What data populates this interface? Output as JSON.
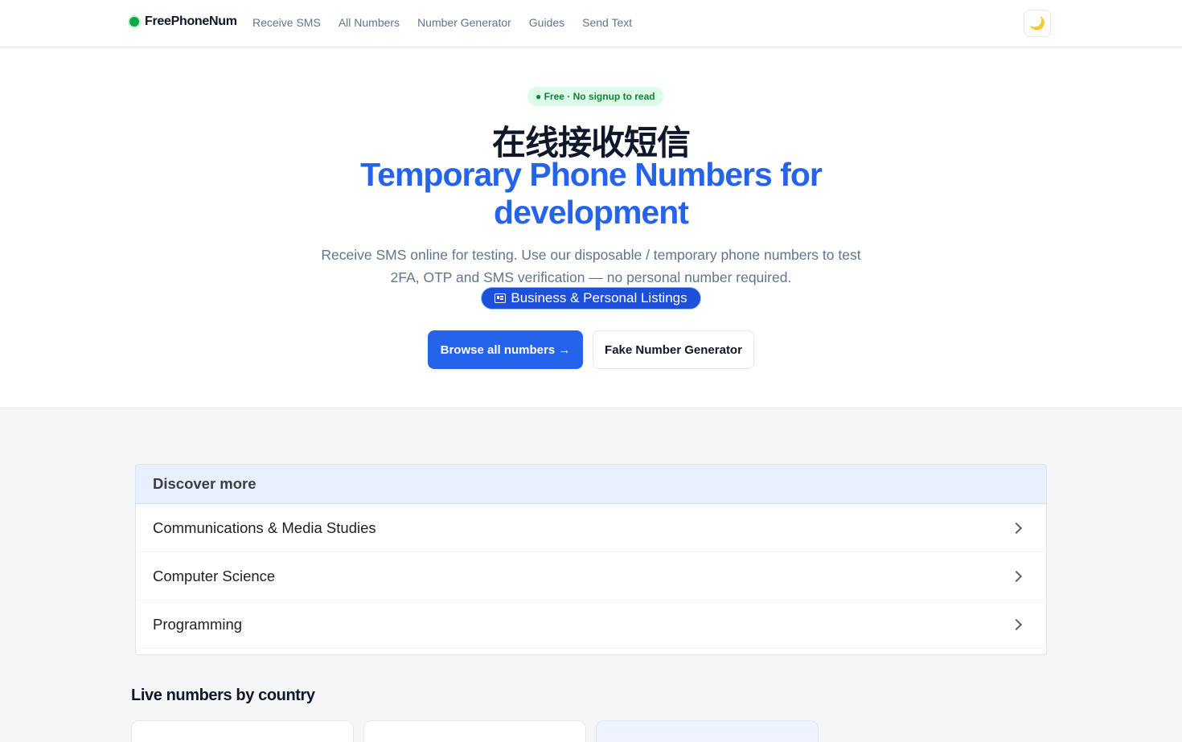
{
  "header": {
    "brand": "FreePhoneNum",
    "nav": [
      "Receive SMS",
      "All Numbers",
      "Number Generator",
      "Guides",
      "Send Text"
    ],
    "theme_icon": "moon-icon",
    "theme_glyph": "🌙"
  },
  "hero": {
    "pill": "● Free · No signup to read",
    "cn_title": "在线接收短信",
    "title": "Temporary Phone Numbers for development",
    "subtitle": "Receive SMS online for testing. Use our disposable / temporary phone numbers to test 2FA, OTP and SMS verification — no personal number required.",
    "listing_badge": "Business & Personal Listings",
    "primary_button": "Browse all numbers →",
    "secondary_button": "Fake Number Generator"
  },
  "discover": {
    "heading": "Discover more",
    "items": [
      "Communications & Media Studies",
      "Computer Science",
      "Programming"
    ]
  },
  "live": {
    "heading": "Live numbers by country"
  },
  "colors": {
    "accent": "#2563eb",
    "brand_dot": "#16a34a",
    "pill_bg": "#dcfce7"
  }
}
